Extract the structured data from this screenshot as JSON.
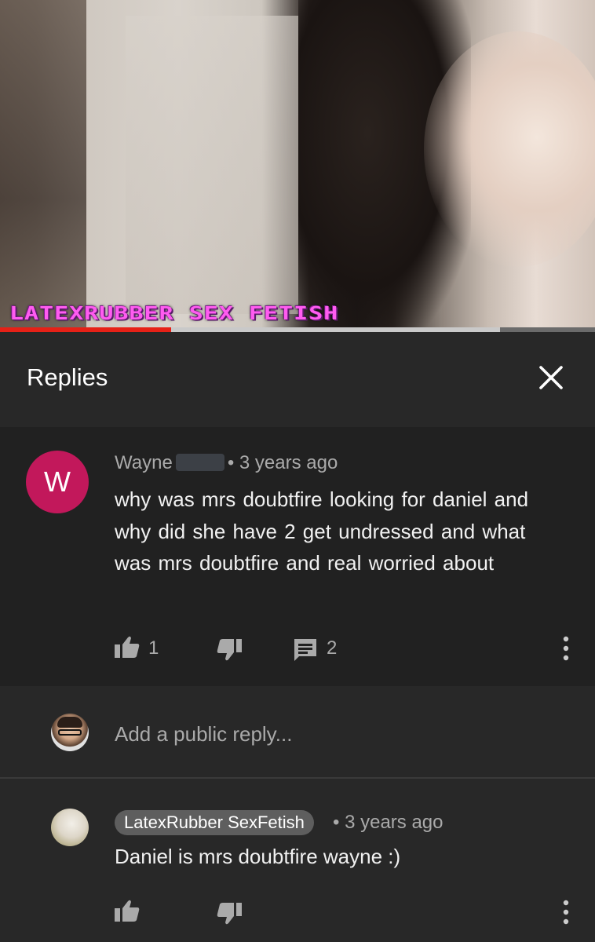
{
  "video": {
    "watermark": "LATEXRUBBER SEX FETISH",
    "progress_played_fraction": 0.287,
    "progress_buffered_fraction": 0.84
  },
  "panel": {
    "title": "Replies",
    "close_icon": "close-icon"
  },
  "comment": {
    "author": "Wayne",
    "time": "3 years ago",
    "text": "why was mrs doubtfire  looking  for  daniel and why did she have 2 get undressed  and what was mrs doubtfire  and real  worried about",
    "avatar_letter": "W",
    "avatar_color": "#c2185b",
    "likes": "1",
    "replies": "2"
  },
  "reply_box": {
    "placeholder": "Add a public reply..."
  },
  "reply": {
    "author": "LatexRubber SexFetish",
    "time": "3 years ago",
    "text": "Daniel is mrs doubtfire wayne :)"
  },
  "colors": {
    "background": "#212121",
    "header_bg": "#282828",
    "progress_played": "#e62117",
    "secondary_text": "#aaaaaa"
  }
}
